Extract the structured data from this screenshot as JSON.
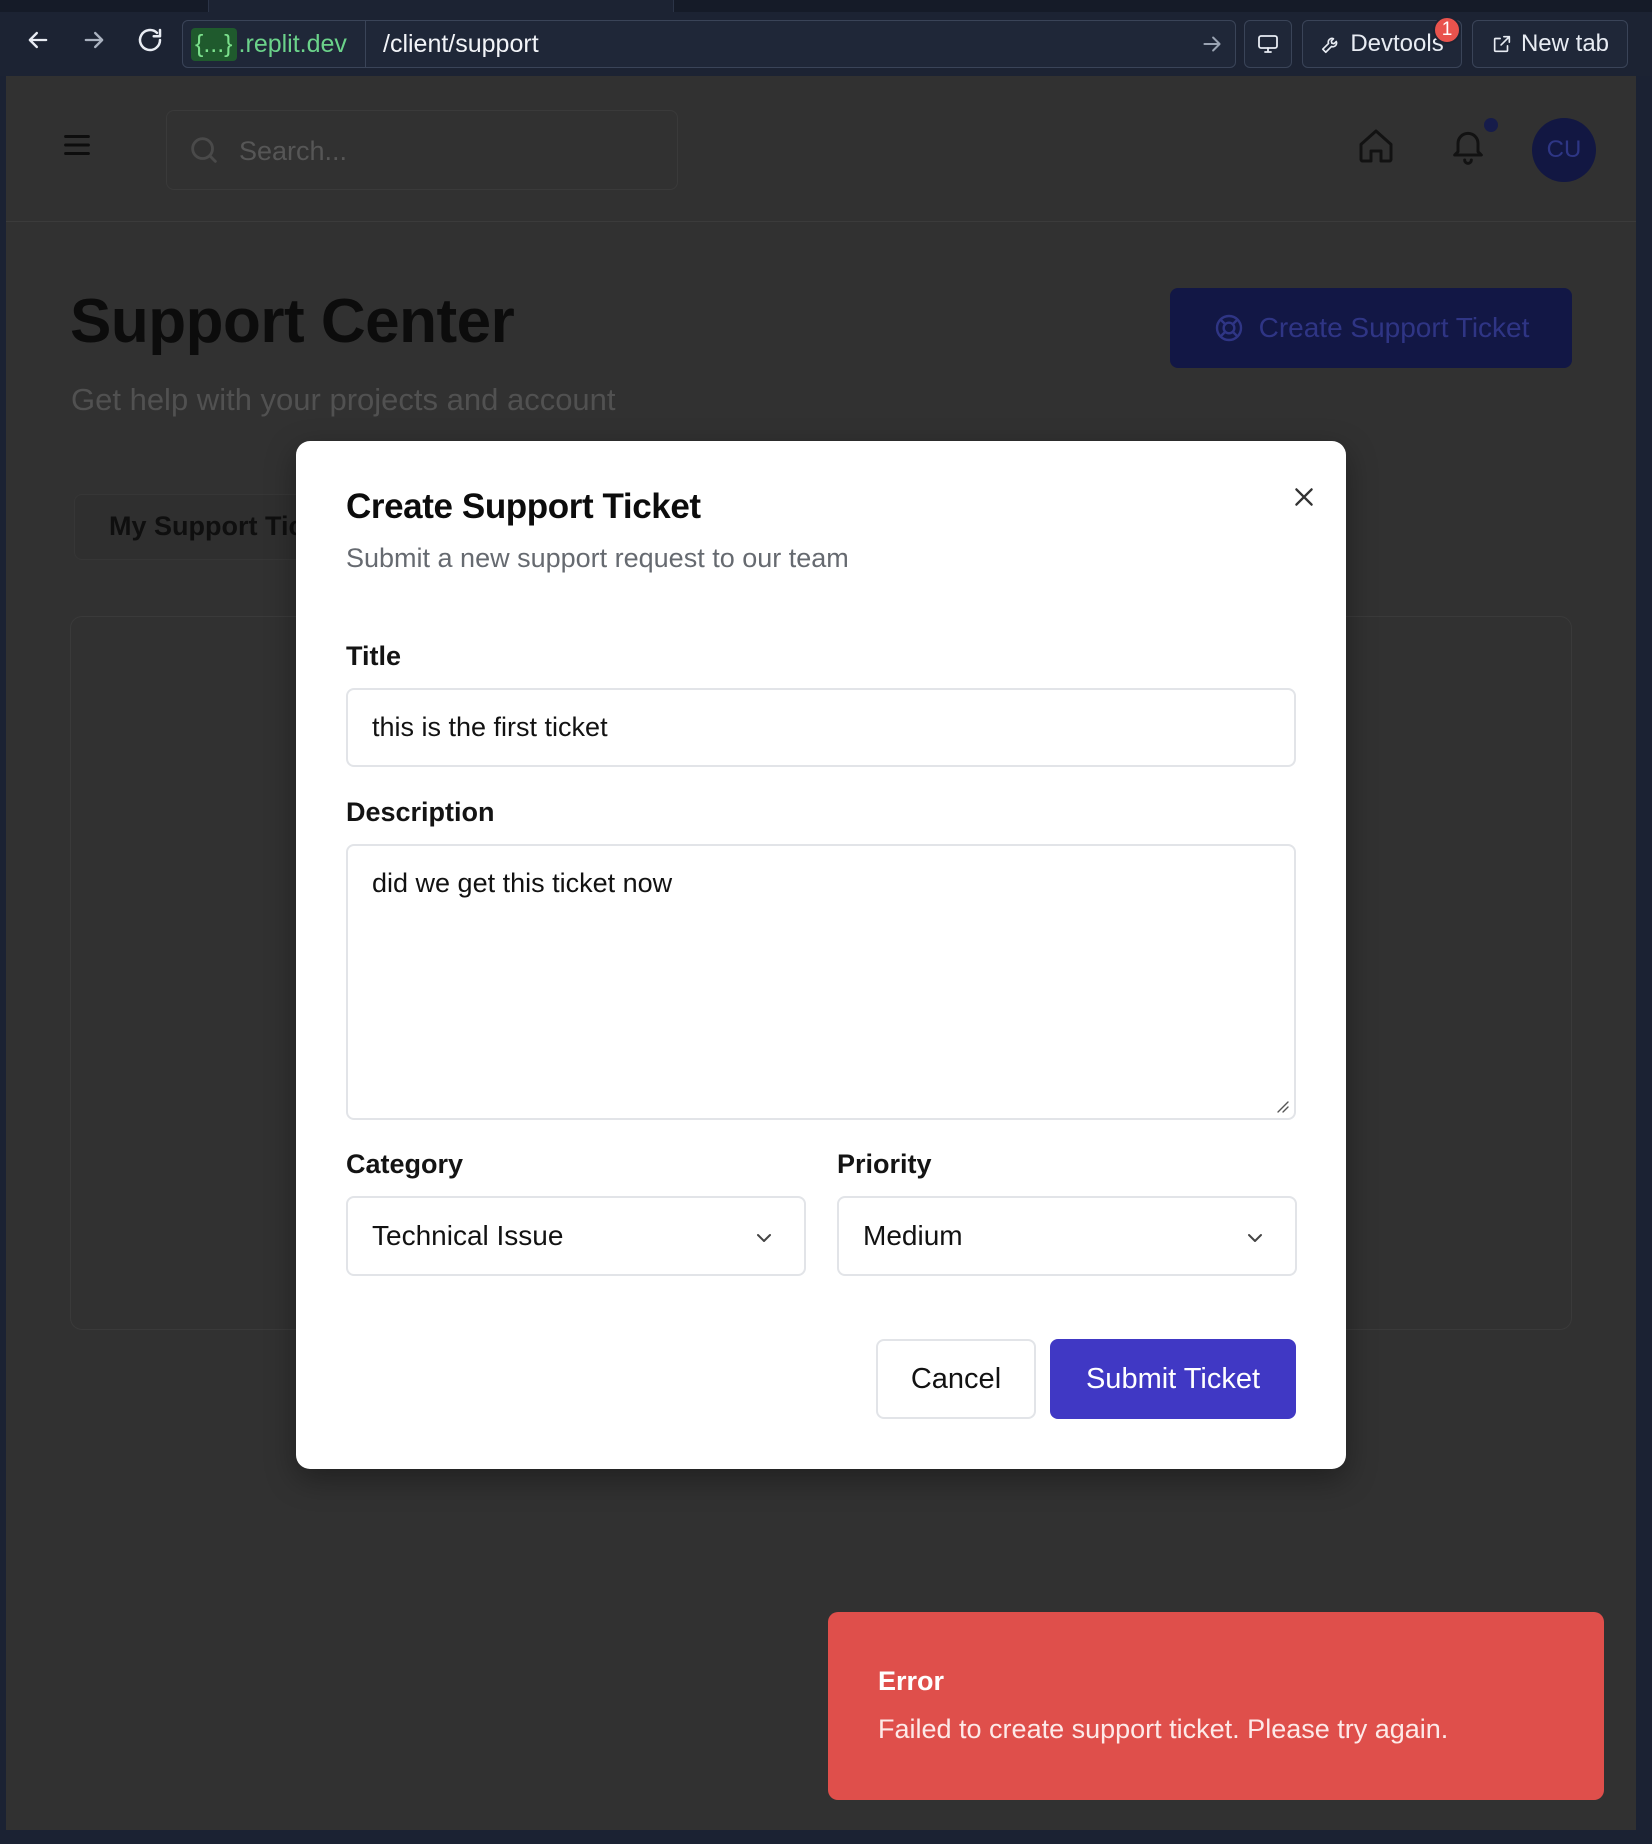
{
  "browser": {
    "url_host_chip": "{...}",
    "url_host_suffix": ".replit.dev",
    "url_path": "/client/support",
    "devtools_label": "Devtools",
    "devtools_badge": "1",
    "new_tab_label": "New tab"
  },
  "header": {
    "search_placeholder": "Search...",
    "avatar_initials": "CU"
  },
  "page": {
    "title": "Support Center",
    "subtitle": "Get help with your projects and account",
    "create_button": "Create Support Ticket",
    "tab_my_tickets": "My Support Tic"
  },
  "modal": {
    "title": "Create Support Ticket",
    "description": "Submit a new support request to our team",
    "title_label": "Title",
    "title_value": "this is the first ticket",
    "description_label": "Description",
    "description_value": "did we get this ticket now",
    "category_label": "Category",
    "category_value": "Technical Issue",
    "priority_label": "Priority",
    "priority_value": "Medium",
    "cancel_label": "Cancel",
    "submit_label": "Submit Ticket"
  },
  "toast": {
    "title": "Error",
    "message": "Failed to create support ticket. Please try again."
  },
  "colors": {
    "primary": "#4038c4",
    "error": "#df4f4b",
    "overlay_bg": "#313131",
    "chrome_bg": "#1c2333"
  }
}
